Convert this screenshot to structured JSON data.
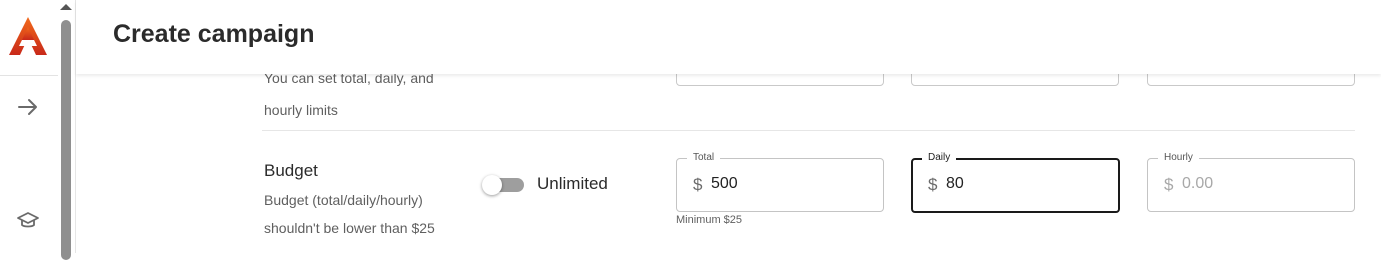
{
  "app": {
    "logo": "autonomous-logo-icon"
  },
  "nav": {
    "items": [
      {
        "icon": "arrow-right-icon"
      },
      {
        "icon": "graduation-cap-icon"
      }
    ]
  },
  "header": {
    "title": "Create campaign"
  },
  "previous_section": {
    "help_text": "You can set total, daily, and hourly limits"
  },
  "budget": {
    "title": "Budget",
    "help_text": "Budget (total/daily/hourly) shouldn't be lower than $25",
    "toggle": {
      "label": "Unlimited",
      "on": false
    },
    "currency_symbol": "$",
    "fields": {
      "total": {
        "label": "Total",
        "value": "500",
        "placeholder": ""
      },
      "daily": {
        "label": "Daily",
        "value": "80",
        "placeholder": ""
      },
      "hourly": {
        "label": "Hourly",
        "value": "",
        "placeholder": "0.00"
      }
    },
    "minimum_hint": "Minimum $25"
  },
  "colors": {
    "brand_orange": "#e8531d",
    "brand_red": "#c8291a",
    "focus_border": "#1a1a1a"
  }
}
